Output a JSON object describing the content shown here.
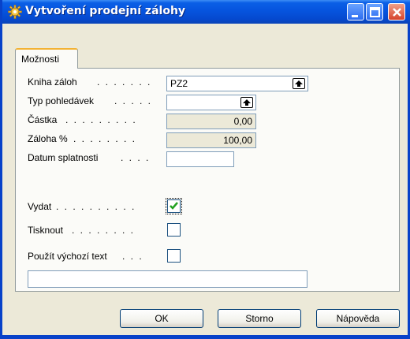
{
  "window": {
    "title": "Vytvoření prodejní zálohy",
    "icon": "gear-icon"
  },
  "tabs": [
    {
      "label": "Možnosti",
      "active": true
    }
  ],
  "fields": {
    "kniha_zaloh": {
      "label": "Kniha záloh",
      "dots": ". . . . . . .",
      "value": "PZ2"
    },
    "typ_pohledavek": {
      "label": "Typ pohledávek",
      "dots": ". . . . .",
      "value": ""
    },
    "castka": {
      "label": "Částka",
      "dots": ". . . . . . . . .",
      "value": "0,00"
    },
    "zaloha_pct": {
      "label": "Záloha %",
      "dots": ". . . . . . . .",
      "value": "100,00"
    },
    "datum_splatnosti": {
      "label": "Datum splatnosti",
      "dots": ". . . .",
      "value": ""
    },
    "vydat": {
      "label": "Vydat",
      "dots": ". . . . . . . . . .",
      "checked": true
    },
    "tisknout": {
      "label": "Tisknout",
      "dots": ". . . . . . . .",
      "checked": false
    },
    "pouzit_text": {
      "label": "Použít výchozí text",
      "dots": ". . .",
      "checked": false
    },
    "text_value": ""
  },
  "buttons": {
    "ok": "OK",
    "storno": "Storno",
    "napoveda": "Nápověda"
  },
  "colors": {
    "titlebar": "#0654de",
    "tab_accent": "#f3b234",
    "check": "#21a121"
  }
}
